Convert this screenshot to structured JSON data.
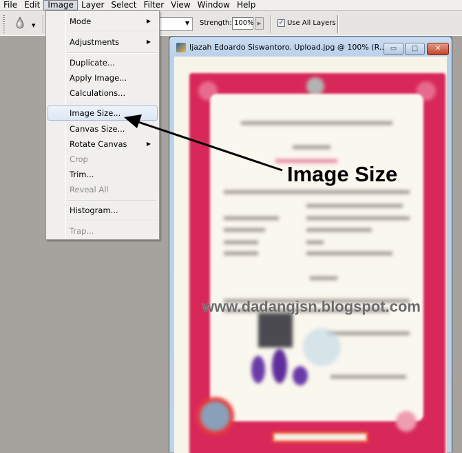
{
  "menubar": {
    "items": [
      "File",
      "Edit",
      "Image",
      "Layer",
      "Select",
      "Filter",
      "View",
      "Window",
      "Help"
    ],
    "active": "Image"
  },
  "options_bar": {
    "tool_icon": "blur-drop-icon",
    "strength_label": "Strength:",
    "strength_value": "100%",
    "use_all_layers_label": "Use All Layers",
    "use_all_layers_checked": true
  },
  "image_menu": {
    "items": [
      {
        "label": "Mode",
        "submenu": true,
        "enabled": true
      },
      {
        "label": "Adjustments",
        "submenu": true,
        "enabled": true
      },
      {
        "label": "Duplicate...",
        "submenu": false,
        "enabled": true
      },
      {
        "label": "Apply Image...",
        "submenu": false,
        "enabled": true
      },
      {
        "label": "Calculations...",
        "submenu": false,
        "enabled": true
      },
      {
        "label": "Image Size...",
        "submenu": false,
        "enabled": true,
        "highlighted": true
      },
      {
        "label": "Canvas Size...",
        "submenu": false,
        "enabled": true
      },
      {
        "label": "Rotate Canvas",
        "submenu": true,
        "enabled": true
      },
      {
        "label": "Crop",
        "submenu": false,
        "enabled": false
      },
      {
        "label": "Trim...",
        "submenu": false,
        "enabled": true
      },
      {
        "label": "Reveal All",
        "submenu": false,
        "enabled": false
      },
      {
        "label": "Histogram...",
        "submenu": false,
        "enabled": true
      },
      {
        "label": "Trap...",
        "submenu": false,
        "enabled": false
      }
    ],
    "submenu_glyph": "▶"
  },
  "document_window": {
    "title": "Ijazah Edoardo Siswantoro. Upload.jpg @ 100% (R...",
    "minimize_glyph": "▭",
    "maximize_glyph": "□",
    "close_glyph": "✕"
  },
  "annotation": {
    "label": "Image Size",
    "watermark": "www.dadangjsn.blogspot.com"
  },
  "colors": {
    "certificate_border": "#d8285a",
    "highlight": "#dce6f4",
    "workspace": "#a6a39f"
  }
}
